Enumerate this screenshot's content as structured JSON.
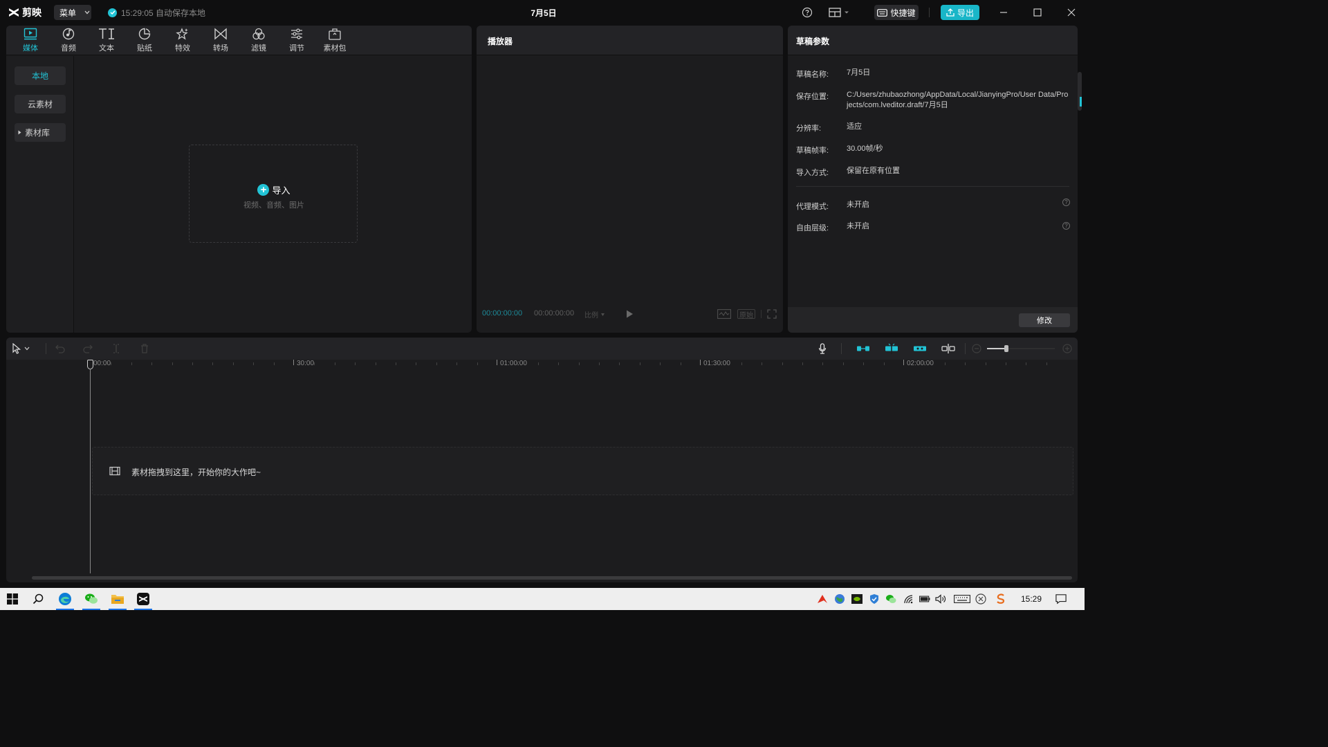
{
  "app": {
    "logo_text": "剪映",
    "menu_label": "菜单",
    "save_status": "15:29:05 自动保存本地",
    "window_title": "7月5日",
    "shortcut_label": "快捷键",
    "export_label": "导出"
  },
  "colors": {
    "accent": "#22c3d5",
    "panel": "#1c1c1e",
    "background": "#0f0f10"
  },
  "media_tools": [
    {
      "label": "媒体",
      "icon": "media-icon"
    },
    {
      "label": "音频",
      "icon": "audio-icon"
    },
    {
      "label": "文本",
      "icon": "text-icon"
    },
    {
      "label": "贴纸",
      "icon": "sticker-icon"
    },
    {
      "label": "特效",
      "icon": "effects-icon"
    },
    {
      "label": "转场",
      "icon": "transition-icon"
    },
    {
      "label": "滤镜",
      "icon": "filter-icon"
    },
    {
      "label": "调节",
      "icon": "adjust-icon"
    },
    {
      "label": "素材包",
      "icon": "asset-pack-icon"
    }
  ],
  "media_sidebar": [
    {
      "label": "本地"
    },
    {
      "label": "云素材"
    },
    {
      "label": "素材库"
    }
  ],
  "import": {
    "label": "导入",
    "hint": "视频、音频、图片"
  },
  "player": {
    "title": "播放器",
    "time_current": "00:00:00:00",
    "time_total": "00:00:00:00",
    "ratio_label": "比例",
    "original_label": "原始"
  },
  "params": {
    "title": "草稿参数",
    "rows": [
      {
        "label": "草稿名称:",
        "value": "7月5日"
      },
      {
        "label": "保存位置:",
        "value": "C:/Users/zhubaozhong/AppData/Local/JianyingPro/User Data/Projects/com.lveditor.draft/7月5日"
      },
      {
        "label": "分辨率:",
        "value": "适应"
      },
      {
        "label": "草稿帧率:",
        "value": "30.00帧/秒"
      },
      {
        "label": "导入方式:",
        "value": "保留在原有位置"
      },
      {
        "label": "代理模式:",
        "value": "未开启"
      },
      {
        "label": "自由层级:",
        "value": "未开启"
      }
    ],
    "modify_label": "修改"
  },
  "timeline": {
    "ruler_labels": [
      "00:00",
      "30:00",
      "01:00:00",
      "01:30:00",
      "02:00:00"
    ],
    "drop_hint": "素材拖拽到这里，开始你的大作吧~"
  },
  "taskbar": {
    "clock": "15:29"
  }
}
